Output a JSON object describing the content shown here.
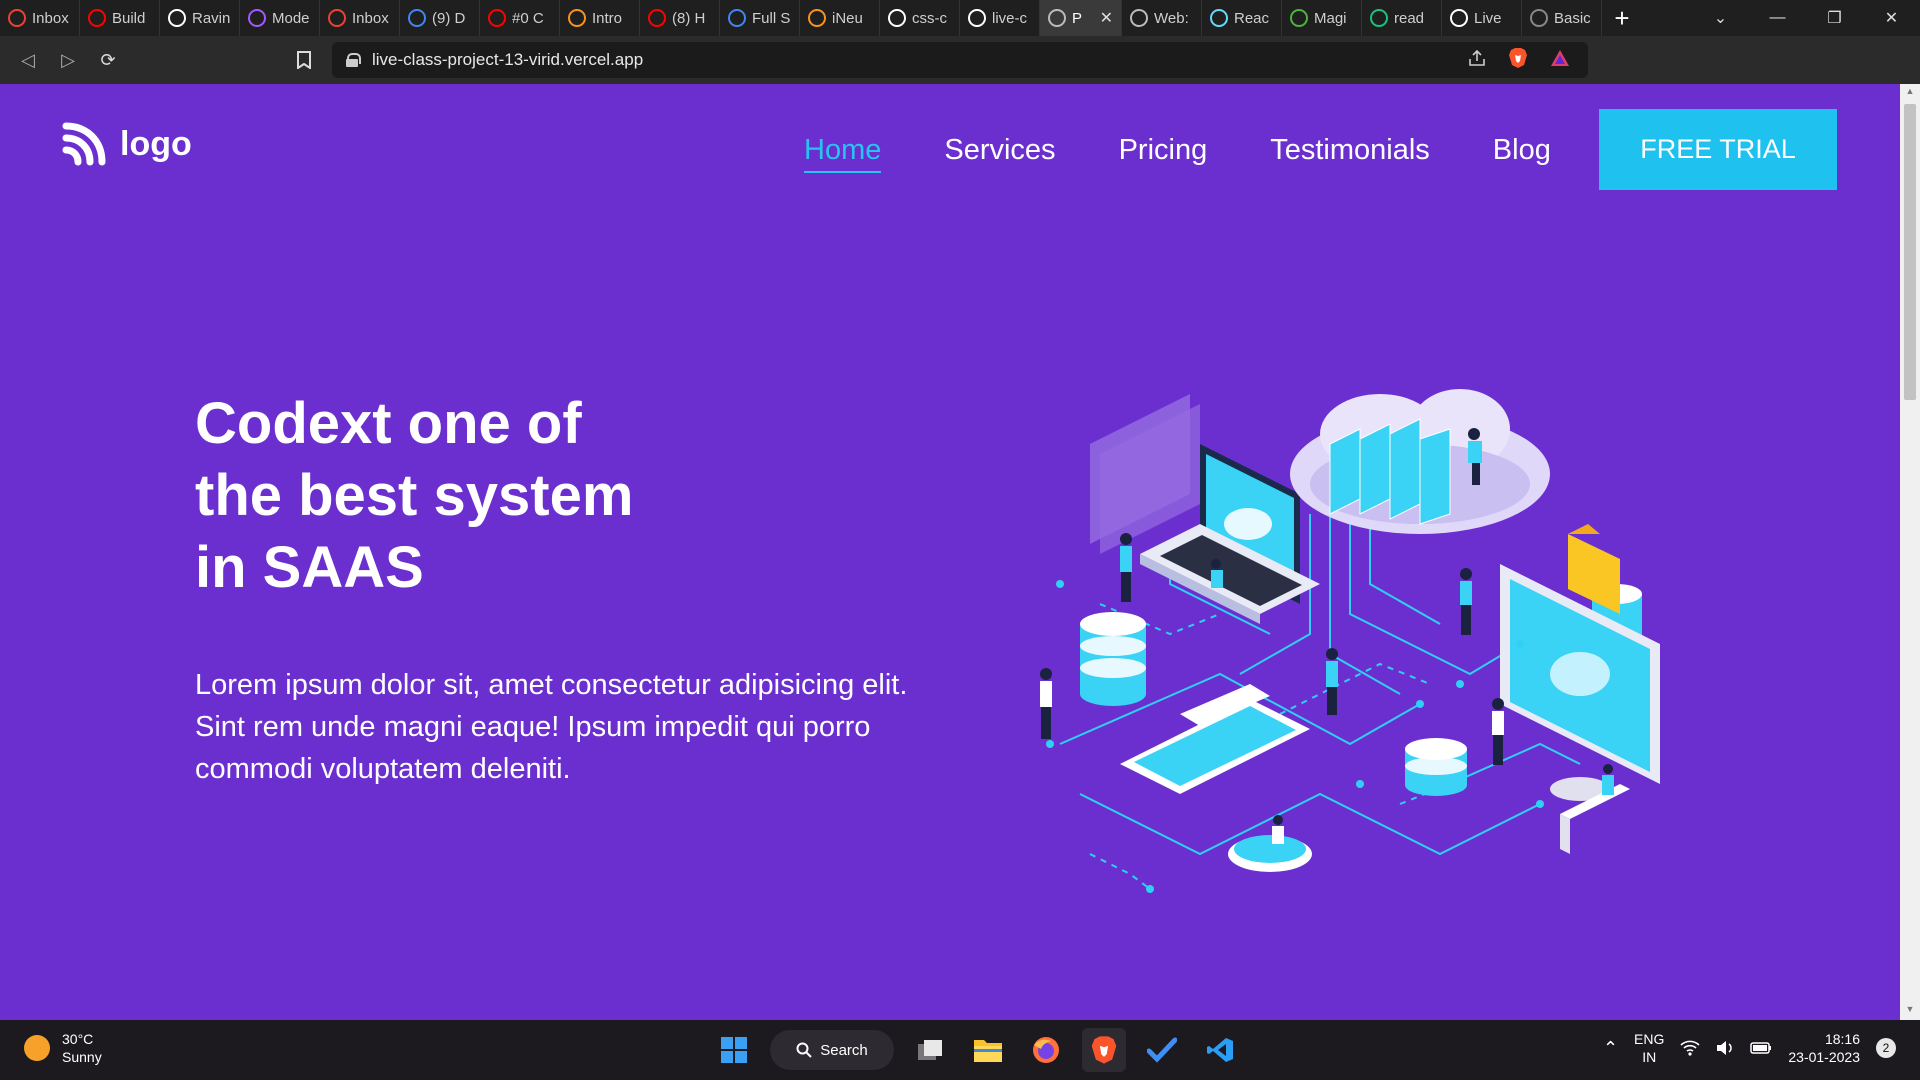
{
  "browser": {
    "tabs": [
      {
        "label": "Inbox",
        "icon": "gmail-icon",
        "color": "#ea4335"
      },
      {
        "label": "Build",
        "icon": "youtube-icon",
        "color": "#ff0000"
      },
      {
        "label": "Ravin",
        "icon": "github-icon",
        "color": "#ffffff"
      },
      {
        "label": "Mode",
        "icon": "figma-icon",
        "color": "#a259ff"
      },
      {
        "label": "Inbox",
        "icon": "gmail-icon",
        "color": "#ea4335"
      },
      {
        "label": "(9) D",
        "icon": "chrome-icon",
        "color": "#4285f4"
      },
      {
        "label": "#0 C",
        "icon": "youtube-icon",
        "color": "#ff0000"
      },
      {
        "label": "Intro",
        "icon": "ineuron-icon",
        "color": "#f7931e"
      },
      {
        "label": "(8) H",
        "icon": "youtube-icon",
        "color": "#ff0000"
      },
      {
        "label": "Full S",
        "icon": "docs-icon",
        "color": "#4285f4"
      },
      {
        "label": "iNeu",
        "icon": "ineuron-icon",
        "color": "#f7931e"
      },
      {
        "label": "css-c",
        "icon": "github-icon",
        "color": "#ffffff"
      },
      {
        "label": "live-c",
        "icon": "vercel-icon",
        "color": "#ffffff"
      },
      {
        "label": "P",
        "icon": "globe-icon",
        "color": "#bbbbbb",
        "active": true
      },
      {
        "label": "Web:",
        "icon": "globe-icon",
        "color": "#bbbbbb"
      },
      {
        "label": "Reac",
        "icon": "react-icon",
        "color": "#61dafb"
      },
      {
        "label": "Magi",
        "icon": "mongodb-icon",
        "color": "#4db33d"
      },
      {
        "label": "read",
        "icon": "chatgpt-icon",
        "color": "#19c37d"
      },
      {
        "label": "Live",
        "icon": "blank-page-icon",
        "color": "#ffffff"
      },
      {
        "label": "Basic",
        "icon": "markdown-icon",
        "color": "#888888"
      }
    ],
    "new_tab": "+",
    "url": "live-class-project-13-virid.vercel.app"
  },
  "site": {
    "logo_text": "logo",
    "nav": [
      {
        "label": "Home",
        "active": true
      },
      {
        "label": "Services"
      },
      {
        "label": "Pricing"
      },
      {
        "label": "Testimonials"
      },
      {
        "label": "Blog"
      }
    ],
    "cta_label": "FREE TRIAL",
    "hero_title_lines": [
      "Codext one of",
      "the best system",
      "in SAAS"
    ],
    "hero_text": "Lorem ipsum dolor sit, amet consectetur adipisicing elit. Sint rem unde magni eaque! Ipsum impedit qui porro commodi voluptatem deleniti.",
    "colors": {
      "background": "#6c2fcf",
      "accent": "#1fc2ef",
      "text": "#ffffff"
    }
  },
  "taskbar": {
    "weather_temp": "30°C",
    "weather_desc": "Sunny",
    "search_label": "Search",
    "lang_line1": "ENG",
    "lang_line2": "IN",
    "time": "18:16",
    "date": "23-01-2023",
    "notification_count": "2"
  }
}
